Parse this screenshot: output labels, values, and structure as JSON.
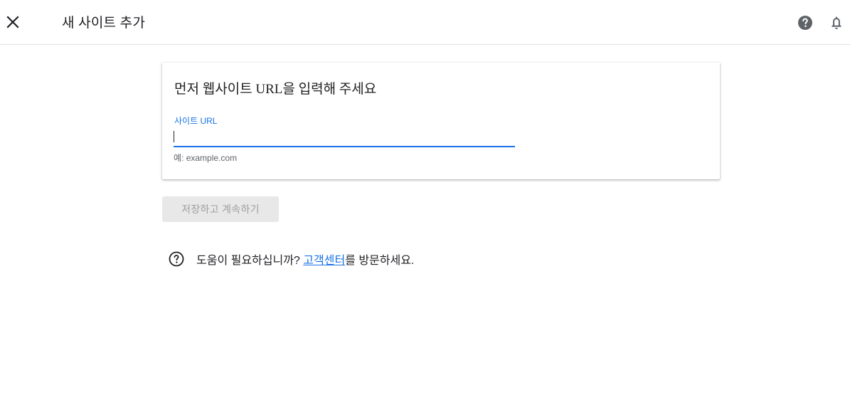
{
  "header": {
    "title": "새 사이트 추가",
    "close_icon": "close-icon",
    "help_icon": "help-circle-icon",
    "notifications_icon": "bell-icon"
  },
  "card": {
    "title": "먼저 웹사이트 URL을 입력해 주세요",
    "field_label": "사이트 URL",
    "field_value": "",
    "field_hint": "예: example.com"
  },
  "actions": {
    "save_label": "저장하고 계속하기"
  },
  "help": {
    "icon": "help-outline-icon",
    "prefix": "도움이 필요하십니까? ",
    "link_label": "고객센터",
    "suffix": "를 방문하세요."
  },
  "colors": {
    "accent": "#1a73e8",
    "icon": "#5f6368",
    "disabled_bg": "#e8e8e8",
    "disabled_text": "#9e9e9e"
  }
}
